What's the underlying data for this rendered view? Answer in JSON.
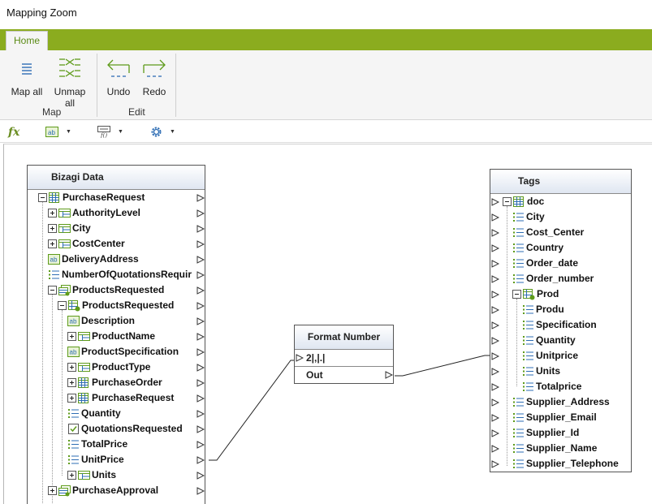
{
  "window": {
    "title": "Mapping Zoom"
  },
  "ribbon": {
    "tab_home": "Home",
    "map_all": "Map all",
    "unmap_all": "Unmap all",
    "undo": "Undo",
    "redo": "Redo",
    "group_map": "Map",
    "group_edit": "Edit"
  },
  "toolbar2": {
    "fx": "fx"
  },
  "bizagi": {
    "title": "Bizagi Data",
    "rows": [
      {
        "label": "PurchaseRequest",
        "indent": 0,
        "icon": "table-icon",
        "exp": "minus"
      },
      {
        "label": "AuthorityLevel",
        "indent": 1,
        "icon": "entity-icon",
        "exp": "plus"
      },
      {
        "label": "City",
        "indent": 1,
        "icon": "entity-icon",
        "exp": "plus"
      },
      {
        "label": "CostCenter",
        "indent": 1,
        "icon": "entity-icon",
        "exp": "plus"
      },
      {
        "label": "DeliveryAddress",
        "indent": 1,
        "icon": "text-attr-icon",
        "exp": ""
      },
      {
        "label": "NumberOfQuotationsRequir",
        "indent": 1,
        "icon": "number-attr-icon",
        "exp": ""
      },
      {
        "label": "ProductsRequested",
        "indent": 1,
        "icon": "collection-icon",
        "exp": "minus"
      },
      {
        "label": "ProductsRequested",
        "indent": 2,
        "icon": "collection-table-icon",
        "exp": "minus"
      },
      {
        "label": "Description",
        "indent": 3,
        "icon": "text-attr-icon",
        "exp": ""
      },
      {
        "label": "ProductName",
        "indent": 3,
        "icon": "entity-icon",
        "exp": "plus"
      },
      {
        "label": "ProductSpecification",
        "indent": 3,
        "icon": "text-attr-icon",
        "exp": ""
      },
      {
        "label": "ProductType",
        "indent": 3,
        "icon": "entity-icon",
        "exp": "plus"
      },
      {
        "label": "PurchaseOrder",
        "indent": 3,
        "icon": "table-icon",
        "exp": "plus"
      },
      {
        "label": "PurchaseRequest",
        "indent": 3,
        "icon": "table-icon",
        "exp": "plus"
      },
      {
        "label": "Quantity",
        "indent": 3,
        "icon": "number-attr-icon",
        "exp": ""
      },
      {
        "label": "QuotationsRequested",
        "indent": 3,
        "icon": "checkbox-attr-icon",
        "exp": ""
      },
      {
        "label": "TotalPrice",
        "indent": 3,
        "icon": "number-attr-icon",
        "exp": ""
      },
      {
        "label": "UnitPrice",
        "indent": 3,
        "icon": "number-attr-icon",
        "exp": ""
      },
      {
        "label": "Units",
        "indent": 3,
        "icon": "entity-icon",
        "exp": "plus"
      },
      {
        "label": "PurchaseApproval",
        "indent": 1,
        "icon": "collection-icon",
        "exp": "plus"
      }
    ]
  },
  "format_number": {
    "title": "Format Number",
    "input_value": "2|,|.|",
    "output_label": "Out"
  },
  "tags": {
    "title": "Tags",
    "rows": [
      {
        "label": "doc",
        "indent": 0,
        "icon": "table-icon",
        "exp": "minus"
      },
      {
        "label": "City",
        "indent": 1,
        "icon": "field-icon",
        "exp": ""
      },
      {
        "label": "Cost_Center",
        "indent": 1,
        "icon": "field-icon",
        "exp": ""
      },
      {
        "label": "Country",
        "indent": 1,
        "icon": "field-icon",
        "exp": ""
      },
      {
        "label": "Order_date",
        "indent": 1,
        "icon": "field-icon",
        "exp": ""
      },
      {
        "label": "Order_number",
        "indent": 1,
        "icon": "field-icon",
        "exp": ""
      },
      {
        "label": "Prod",
        "indent": 1,
        "icon": "collection-table-icon",
        "exp": "minus"
      },
      {
        "label": "Produ",
        "indent": 2,
        "icon": "field-icon",
        "exp": ""
      },
      {
        "label": "Specification",
        "indent": 2,
        "icon": "field-icon",
        "exp": ""
      },
      {
        "label": "Quantity",
        "indent": 2,
        "icon": "field-icon",
        "exp": ""
      },
      {
        "label": "Unitprice",
        "indent": 2,
        "icon": "field-icon",
        "exp": ""
      },
      {
        "label": "Units",
        "indent": 2,
        "icon": "field-icon",
        "exp": ""
      },
      {
        "label": "Totalprice",
        "indent": 2,
        "icon": "field-icon",
        "exp": ""
      },
      {
        "label": "Supplier_Address",
        "indent": 1,
        "icon": "field-icon",
        "exp": ""
      },
      {
        "label": "Supplier_Email",
        "indent": 1,
        "icon": "field-icon",
        "exp": ""
      },
      {
        "label": "Supplier_Id",
        "indent": 1,
        "icon": "field-icon",
        "exp": ""
      },
      {
        "label": "Supplier_Name",
        "indent": 1,
        "icon": "field-icon",
        "exp": ""
      },
      {
        "label": "Supplier_Telephone",
        "indent": 1,
        "icon": "field-icon",
        "exp": ""
      }
    ]
  },
  "colors": {
    "ribbon_green": "#8bac1f",
    "icon_green": "#5e9b1a",
    "icon_blue": "#2e6db4"
  }
}
